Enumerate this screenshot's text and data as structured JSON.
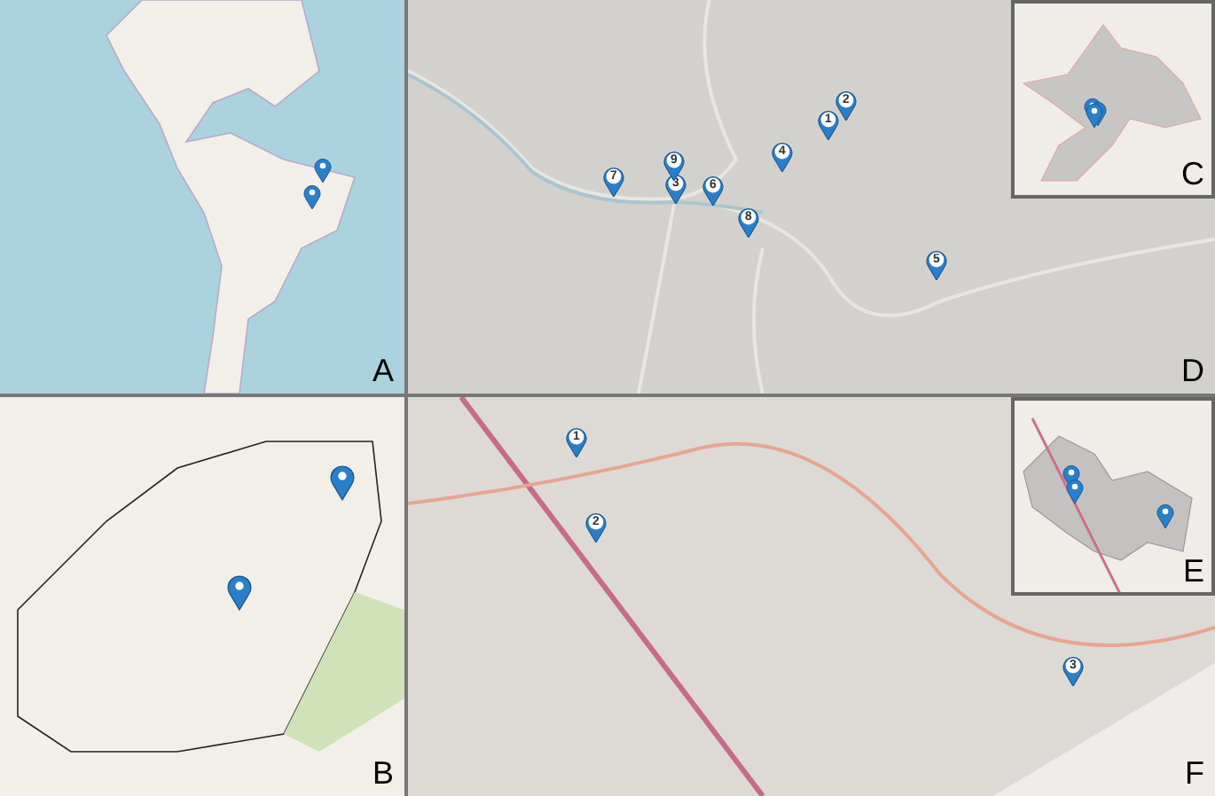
{
  "panels": [
    {
      "label": "A",
      "pins": [
        {
          "kind": "marker"
        },
        {
          "kind": "marker"
        }
      ]
    },
    {
      "label": "D",
      "pins": [
        {
          "kind": "numbered",
          "label": "1"
        },
        {
          "kind": "numbered",
          "label": "2"
        },
        {
          "kind": "numbered",
          "label": "3"
        },
        {
          "kind": "numbered",
          "label": "4"
        },
        {
          "kind": "numbered",
          "label": "5"
        },
        {
          "kind": "numbered",
          "label": "6"
        },
        {
          "kind": "numbered",
          "label": "7"
        },
        {
          "kind": "numbered",
          "label": "8"
        },
        {
          "kind": "numbered",
          "label": "9"
        }
      ],
      "inset": {
        "label": "C",
        "pins": [
          {
            "kind": "marker"
          },
          {
            "kind": "marker"
          },
          {
            "kind": "marker"
          }
        ]
      }
    },
    {
      "label": "B",
      "pins": [
        {
          "kind": "marker"
        },
        {
          "kind": "marker"
        }
      ]
    },
    {
      "label": "F",
      "pins": [
        {
          "kind": "numbered",
          "label": "1"
        },
        {
          "kind": "numbered",
          "label": "2"
        },
        {
          "kind": "numbered",
          "label": "3"
        }
      ],
      "inset": {
        "label": "E",
        "pins": [
          {
            "kind": "marker"
          },
          {
            "kind": "marker"
          },
          {
            "kind": "marker"
          }
        ]
      }
    }
  ]
}
